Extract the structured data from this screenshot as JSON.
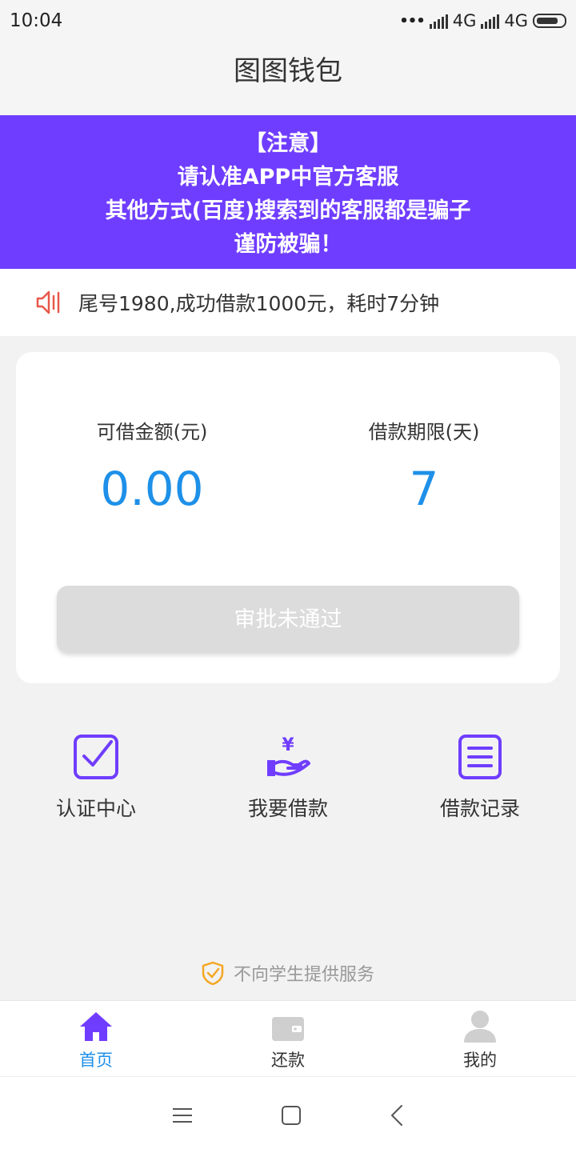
{
  "status_bar": {
    "time": "10:04",
    "network1": "4G",
    "network2": "4G"
  },
  "header": {
    "title": "图图钱包"
  },
  "notice": {
    "lines": [
      "【注意】",
      "请认准APP中官方客服",
      "其他方式(百度)搜索到的客服都是骗子",
      "谨防被骗！"
    ],
    "bg_color": "#6f3dff"
  },
  "ticker": {
    "icon": "speaker-icon",
    "text": "尾号1980,成功借款1000元，耗时7分钟"
  },
  "loan": {
    "amount_label": "可借金额(元)",
    "amount_value": "0.00",
    "term_label": "借款期限(天)",
    "term_value": "7",
    "button_label": "审批未通过",
    "value_color": "#1e90e8"
  },
  "quick_actions": [
    {
      "icon": "checkbox-icon",
      "label": "认证中心"
    },
    {
      "icon": "hand-money-icon",
      "label": "我要借款"
    },
    {
      "icon": "document-list-icon",
      "label": "借款记录"
    }
  ],
  "disclaimer": {
    "icon": "shield-check-icon",
    "text": "不向学生提供服务"
  },
  "tabbar": [
    {
      "icon": "home-icon",
      "label": "首页",
      "active": true
    },
    {
      "icon": "wallet-icon",
      "label": "还款",
      "active": false
    },
    {
      "icon": "user-icon",
      "label": "我的",
      "active": false
    }
  ],
  "accent_color": "#6f3dff"
}
